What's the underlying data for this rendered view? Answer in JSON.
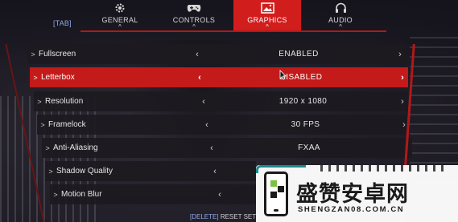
{
  "tabs": {
    "key_hint": "[TAB]",
    "items": [
      {
        "label": "GENERAL",
        "icon": "gear-icon",
        "active": false
      },
      {
        "label": "CONTROLS",
        "icon": "gamepad-icon",
        "active": false
      },
      {
        "label": "GRAPHICS",
        "icon": "image-icon",
        "active": true
      },
      {
        "label": "AUDIO",
        "icon": "headphones-icon",
        "active": false
      }
    ]
  },
  "settings": [
    {
      "name": "Fullscreen",
      "value": "ENABLED"
    },
    {
      "name": "Letterbox",
      "value": "DISABLED",
      "selected": true
    },
    {
      "name": "Resolution",
      "value": "1920 x 1080"
    },
    {
      "name": "Framelock",
      "value": "30 FPS"
    },
    {
      "name": "Anti-Aliasing",
      "value": "FXAA"
    },
    {
      "name": "Shadow Quality",
      "value": ""
    },
    {
      "name": "Motion Blur",
      "value": ""
    }
  ],
  "glyphs": {
    "caret": ">",
    "left_arrow": "‹",
    "right_arrow": "›",
    "chevron_up": "^"
  },
  "footer": {
    "key": "[DELETE]",
    "label": "RESET SETT"
  },
  "watermark": {
    "title": "盛赞安卓网",
    "url": "SHENGZAN08.COM.CN"
  },
  "colors": {
    "accent_red": "#c41a1a",
    "key_blue": "#8fa8e8",
    "row_bg": "#1c1a20"
  }
}
